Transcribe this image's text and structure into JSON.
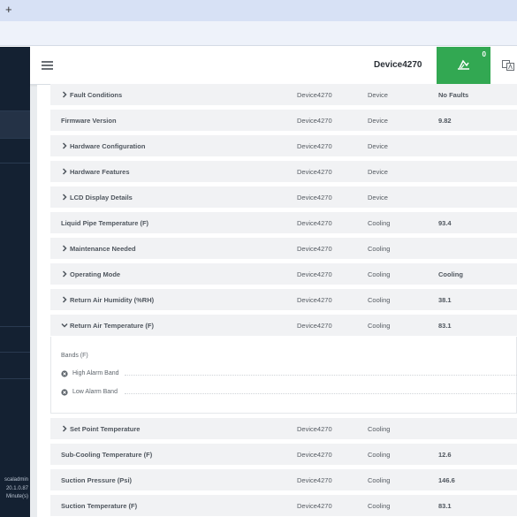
{
  "browser": {
    "new_tab_glyph": "+"
  },
  "sidebar": {
    "footer": {
      "user": "scaladmin",
      "version": "20.1.0.87",
      "refresh": "Minute(s)"
    }
  },
  "header": {
    "device_name": "Device4270",
    "alarm_count": "0",
    "menu_icon": "hamburger-icon",
    "alarm_icon": "alarm-bell-icon",
    "language_icon": "translate-icon"
  },
  "colors": {
    "sidebar": "#142132",
    "alarm_green": "#32a852",
    "row_bg": "#f1f2f4"
  },
  "rows": [
    {
      "name": "Fault Conditions",
      "device": "Device4270",
      "category": "Device",
      "value": "No Faults",
      "expandable": true
    },
    {
      "name": "Firmware Version",
      "device": "Device4270",
      "category": "Device",
      "value": "9.82",
      "expandable": false
    },
    {
      "name": "Hardware Configuration",
      "device": "Device4270",
      "category": "Device",
      "value": "",
      "expandable": true
    },
    {
      "name": "Hardware Features",
      "device": "Device4270",
      "category": "Device",
      "value": "",
      "expandable": true
    },
    {
      "name": "LCD Display Details",
      "device": "Device4270",
      "category": "Device",
      "value": "",
      "expandable": true
    },
    {
      "name": "Liquid Pipe Temperature (F)",
      "device": "Device4270",
      "category": "Cooling",
      "value": "93.4",
      "expandable": false
    },
    {
      "name": "Maintenance Needed",
      "device": "Device4270",
      "category": "Cooling",
      "value": "",
      "expandable": true
    },
    {
      "name": "Operating Mode",
      "device": "Device4270",
      "category": "Cooling",
      "value": "Cooling",
      "expandable": true
    },
    {
      "name": "Return Air Humidity (%RH)",
      "device": "Device4270",
      "category": "Cooling",
      "value": "38.1",
      "expandable": true
    },
    {
      "name": "Return Air Temperature (F)",
      "device": "Device4270",
      "category": "Cooling",
      "value": "83.1",
      "expandable": true,
      "expanded": true
    }
  ],
  "expanded_panel": {
    "bands_label": "Bands (F)",
    "high_alarm": "High Alarm Band",
    "low_alarm": "Low Alarm Band"
  },
  "rows_after": [
    {
      "name": "Set Point Temperature",
      "device": "Device4270",
      "category": "Cooling",
      "value": "",
      "expandable": true
    },
    {
      "name": "Sub-Cooling Temperature (F)",
      "device": "Device4270",
      "category": "Cooling",
      "value": "12.6",
      "expandable": false
    },
    {
      "name": "Suction Pressure (Psi)",
      "device": "Device4270",
      "category": "Cooling",
      "value": "146.6",
      "expandable": false
    },
    {
      "name": "Suction Temperature (F)",
      "device": "Device4270",
      "category": "Cooling",
      "value": "83.1",
      "expandable": false
    }
  ]
}
